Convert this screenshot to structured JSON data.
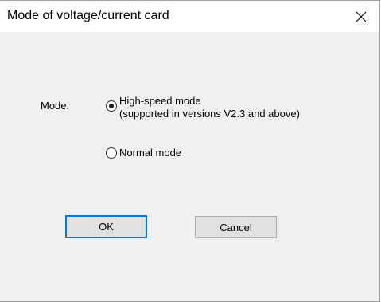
{
  "window": {
    "title": "Mode of voltage/current card",
    "close_glyph": "close-icon"
  },
  "form": {
    "mode_label": "Mode:",
    "options": [
      {
        "label_line1": "High-speed mode",
        "label_line2": "(supported in versions V2.3 and above)",
        "selected": true
      },
      {
        "label_line1": "Normal mode",
        "selected": false
      }
    ]
  },
  "buttons": {
    "ok_label": "OK",
    "cancel_label": "Cancel"
  },
  "colors": {
    "accent": "#0078d7",
    "dialog_bg": "#f0f0f0",
    "titlebar_bg": "#ffffff"
  }
}
